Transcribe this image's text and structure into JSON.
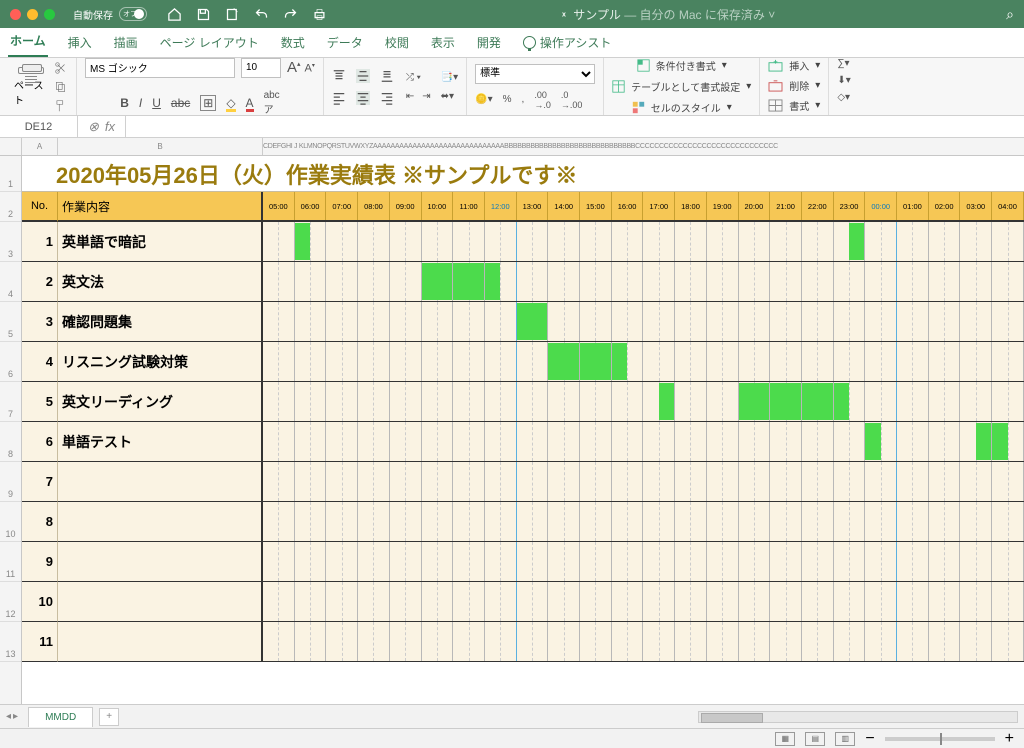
{
  "titlebar": {
    "autosave": "自動保存",
    "autosave_state": "オフ",
    "filename": "サンプル",
    "saved_note": "— 自分の Mac に保存済み"
  },
  "menu": {
    "home": "ホーム",
    "insert": "挿入",
    "draw": "描画",
    "layout": "ページ レイアウト",
    "formula": "数式",
    "data": "データ",
    "review": "校閲",
    "view": "表示",
    "dev": "開発",
    "assist": "操作アシスト"
  },
  "ribbon": {
    "paste": "ペースト",
    "font_name": "MS ゴシック",
    "font_size": "10",
    "number_format": "標準",
    "cond_fmt": "条件付き書式",
    "as_table": "テーブルとして書式設定",
    "cell_style": "セルのスタイル",
    "insert": "挿入",
    "delete": "削除",
    "format": "書式"
  },
  "cellref": "DE12",
  "colrest": "CDEFGHI J KLMNOPQRSTUVWXYZAAAAAAAAAAAAAAAAAAAAAAAAAAAAAABBBBBBBBBBBBBBBBBBBBBBBBBBBBBBCCCCCCCCCCCCCCCCCCCCCCCCCCCCCC",
  "title": "2020年05月26日（火）作業実績表  ※サンプルです※",
  "hdr_no": "No.",
  "hdr_task": "作業内容",
  "hours": [
    "05:00",
    "06:00",
    "07:00",
    "08:00",
    "09:00",
    "10:00",
    "11:00",
    "12:00",
    "13:00",
    "14:00",
    "15:00",
    "16:00",
    "17:00",
    "18:00",
    "19:00",
    "20:00",
    "21:00",
    "22:00",
    "23:00",
    "00:00",
    "01:00",
    "02:00",
    "03:00",
    "04:00"
  ],
  "rows": [
    {
      "no": "1",
      "task": "英単語で暗記",
      "cells": {
        "1": "f50l",
        "18": "f50r"
      }
    },
    {
      "no": "2",
      "task": "英文法",
      "cells": {
        "5": "f100",
        "6": "f100",
        "7": "f50l"
      }
    },
    {
      "no": "3",
      "task": "確認問題集",
      "cells": {
        "8": "f100"
      }
    },
    {
      "no": "4",
      "task": "リスニング試験対策",
      "cells": {
        "9": "f100",
        "10": "f100",
        "11": "f50l"
      }
    },
    {
      "no": "5",
      "task": "英文リーディング",
      "cells": {
        "12": "f50r",
        "15": "f100",
        "16": "f100",
        "17": "f100",
        "18": "f50l"
      }
    },
    {
      "no": "6",
      "task": "単語テスト",
      "cells": {
        "19": "f50l",
        "22": "f50r",
        "23": "f50l"
      }
    },
    {
      "no": "7",
      "task": ""
    },
    {
      "no": "8",
      "task": ""
    },
    {
      "no": "9",
      "task": ""
    },
    {
      "no": "10",
      "task": ""
    },
    {
      "no": "11",
      "task": ""
    }
  ],
  "sheet_tab": "MMDD"
}
